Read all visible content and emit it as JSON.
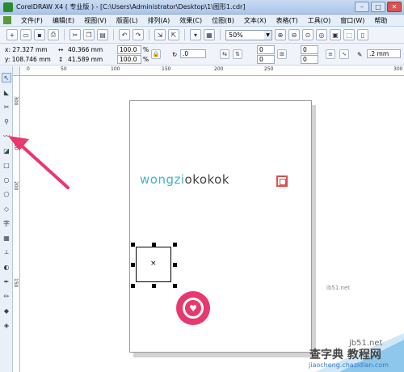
{
  "window": {
    "title": "CorelDRAW X4 ( 专业版 ) - [C:\\Users\\Administrator\\Desktop\\1\\图形1.cdr]"
  },
  "menu": [
    "文件(F)",
    "编辑(E)",
    "视图(V)",
    "版面(L)",
    "排列(A)",
    "效果(C)",
    "位图(B)",
    "文本(X)",
    "表格(T)",
    "工具(O)",
    "窗口(W)",
    "帮助"
  ],
  "toolbar": {
    "zoom": "50%"
  },
  "properties": {
    "x": "x: 27.327 mm",
    "y": "y: 108.746 mm",
    "width": "40.366 mm",
    "height": "41.589 mm",
    "scale_w": "100.0",
    "scale_h": "100.0",
    "percent": "%",
    "rotation": ".0",
    "corner_1": "0",
    "corner_2": "0",
    "corner_3": "0",
    "corner_4": "0",
    "outline": ".2 mm"
  },
  "ruler": {
    "h_labels": [
      "0",
      "50",
      "100",
      "150",
      "200",
      "250",
      "300"
    ],
    "v_labels": [
      "300",
      "250",
      "200",
      "150"
    ]
  },
  "canvas": {
    "logo_part1": "wongzi",
    "logo_part2": "okokok",
    "center_mark": "×"
  },
  "watermark": {
    "site": "jb51.net",
    "brand": "查字典 教程网",
    "url": "jiaocheng.chazidian.com",
    "side": "ib51.net"
  },
  "colors": {
    "accent_pink": "#e8386e",
    "logo_teal": "#3fb4c8",
    "seal_red": "#d9534f"
  }
}
